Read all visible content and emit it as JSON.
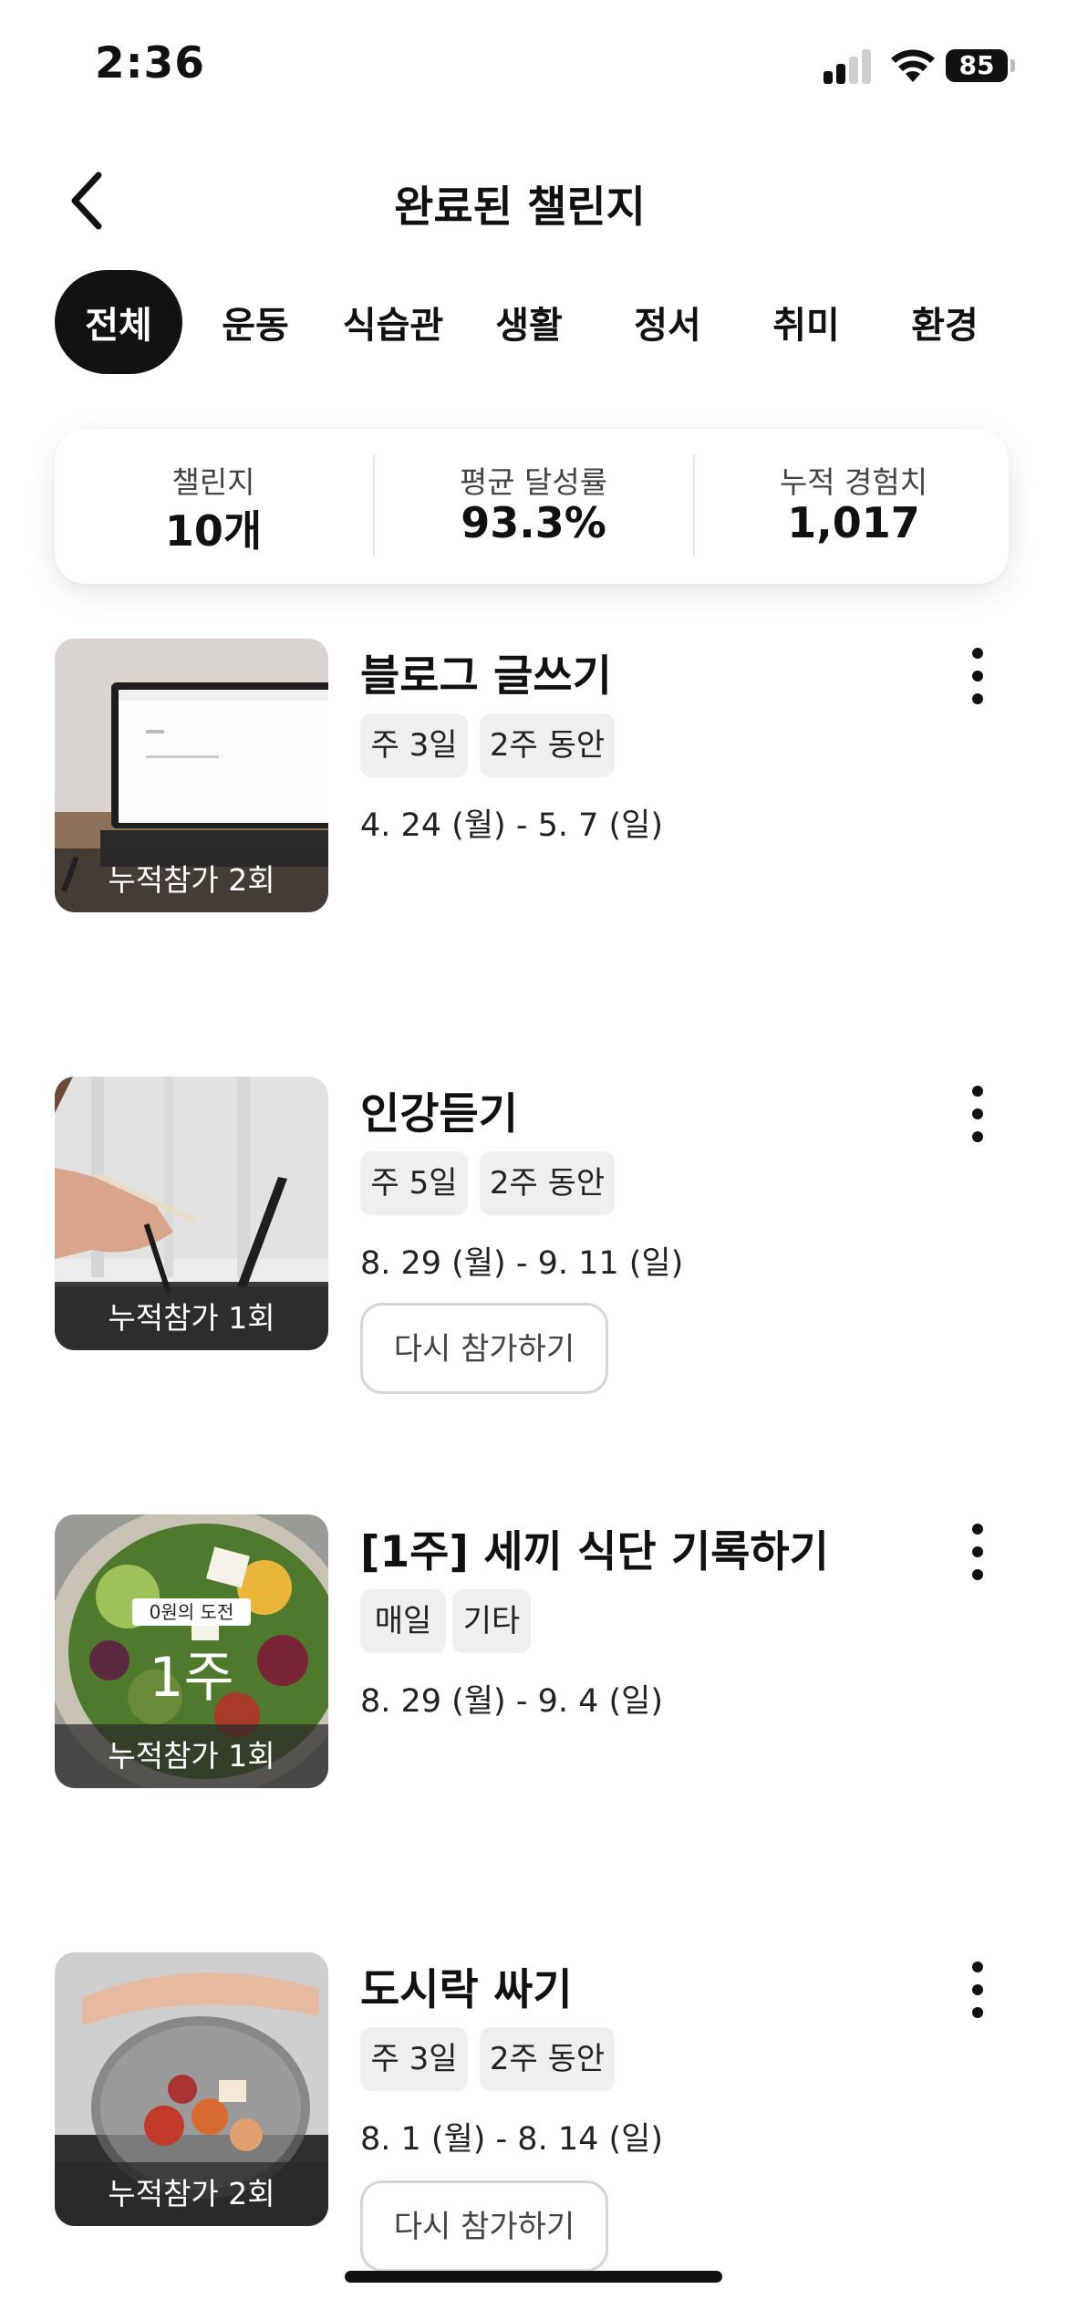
{
  "status_bar": {
    "time": "2:36",
    "battery": "85"
  },
  "header": {
    "title": "완료된 챌린지"
  },
  "tabs": [
    "전체",
    "운동",
    "식습관",
    "생활",
    "정서",
    "취미",
    "환경"
  ],
  "summary": [
    {
      "label": "챌린지",
      "value": "10개"
    },
    {
      "label": "평균 달성률",
      "value": "93.3%"
    },
    {
      "label": "누적 경험치",
      "value": "1,017"
    }
  ],
  "challenges": [
    {
      "title": "블로그 글쓰기",
      "tags": [
        "주 3일",
        "2주 동안"
      ],
      "dates": "4. 24 (월) - 5. 7 (일)",
      "participation": "누적참가 2회"
    },
    {
      "title": "인강듣기",
      "tags": [
        "주 5일",
        "2주 동안"
      ],
      "dates": "8. 29 (월) - 9. 11 (일)",
      "participation": "누적참가 1회",
      "retry": "다시 참가하기"
    },
    {
      "title": "[1주] 세끼 식단 기록하기",
      "tags": [
        "매일",
        "기타"
      ],
      "dates": "8. 29 (월) - 9. 4 (일)",
      "participation": "누적참가 1회",
      "overlay_label": "0원의 도전",
      "overlay_big": "1주"
    },
    {
      "title": "도시락 싸기",
      "tags": [
        "주 3일",
        "2주 동안"
      ],
      "dates": "8. 1 (월) - 8. 14 (일)",
      "participation": "누적참가 2회",
      "retry": "다시 참가하기"
    }
  ]
}
